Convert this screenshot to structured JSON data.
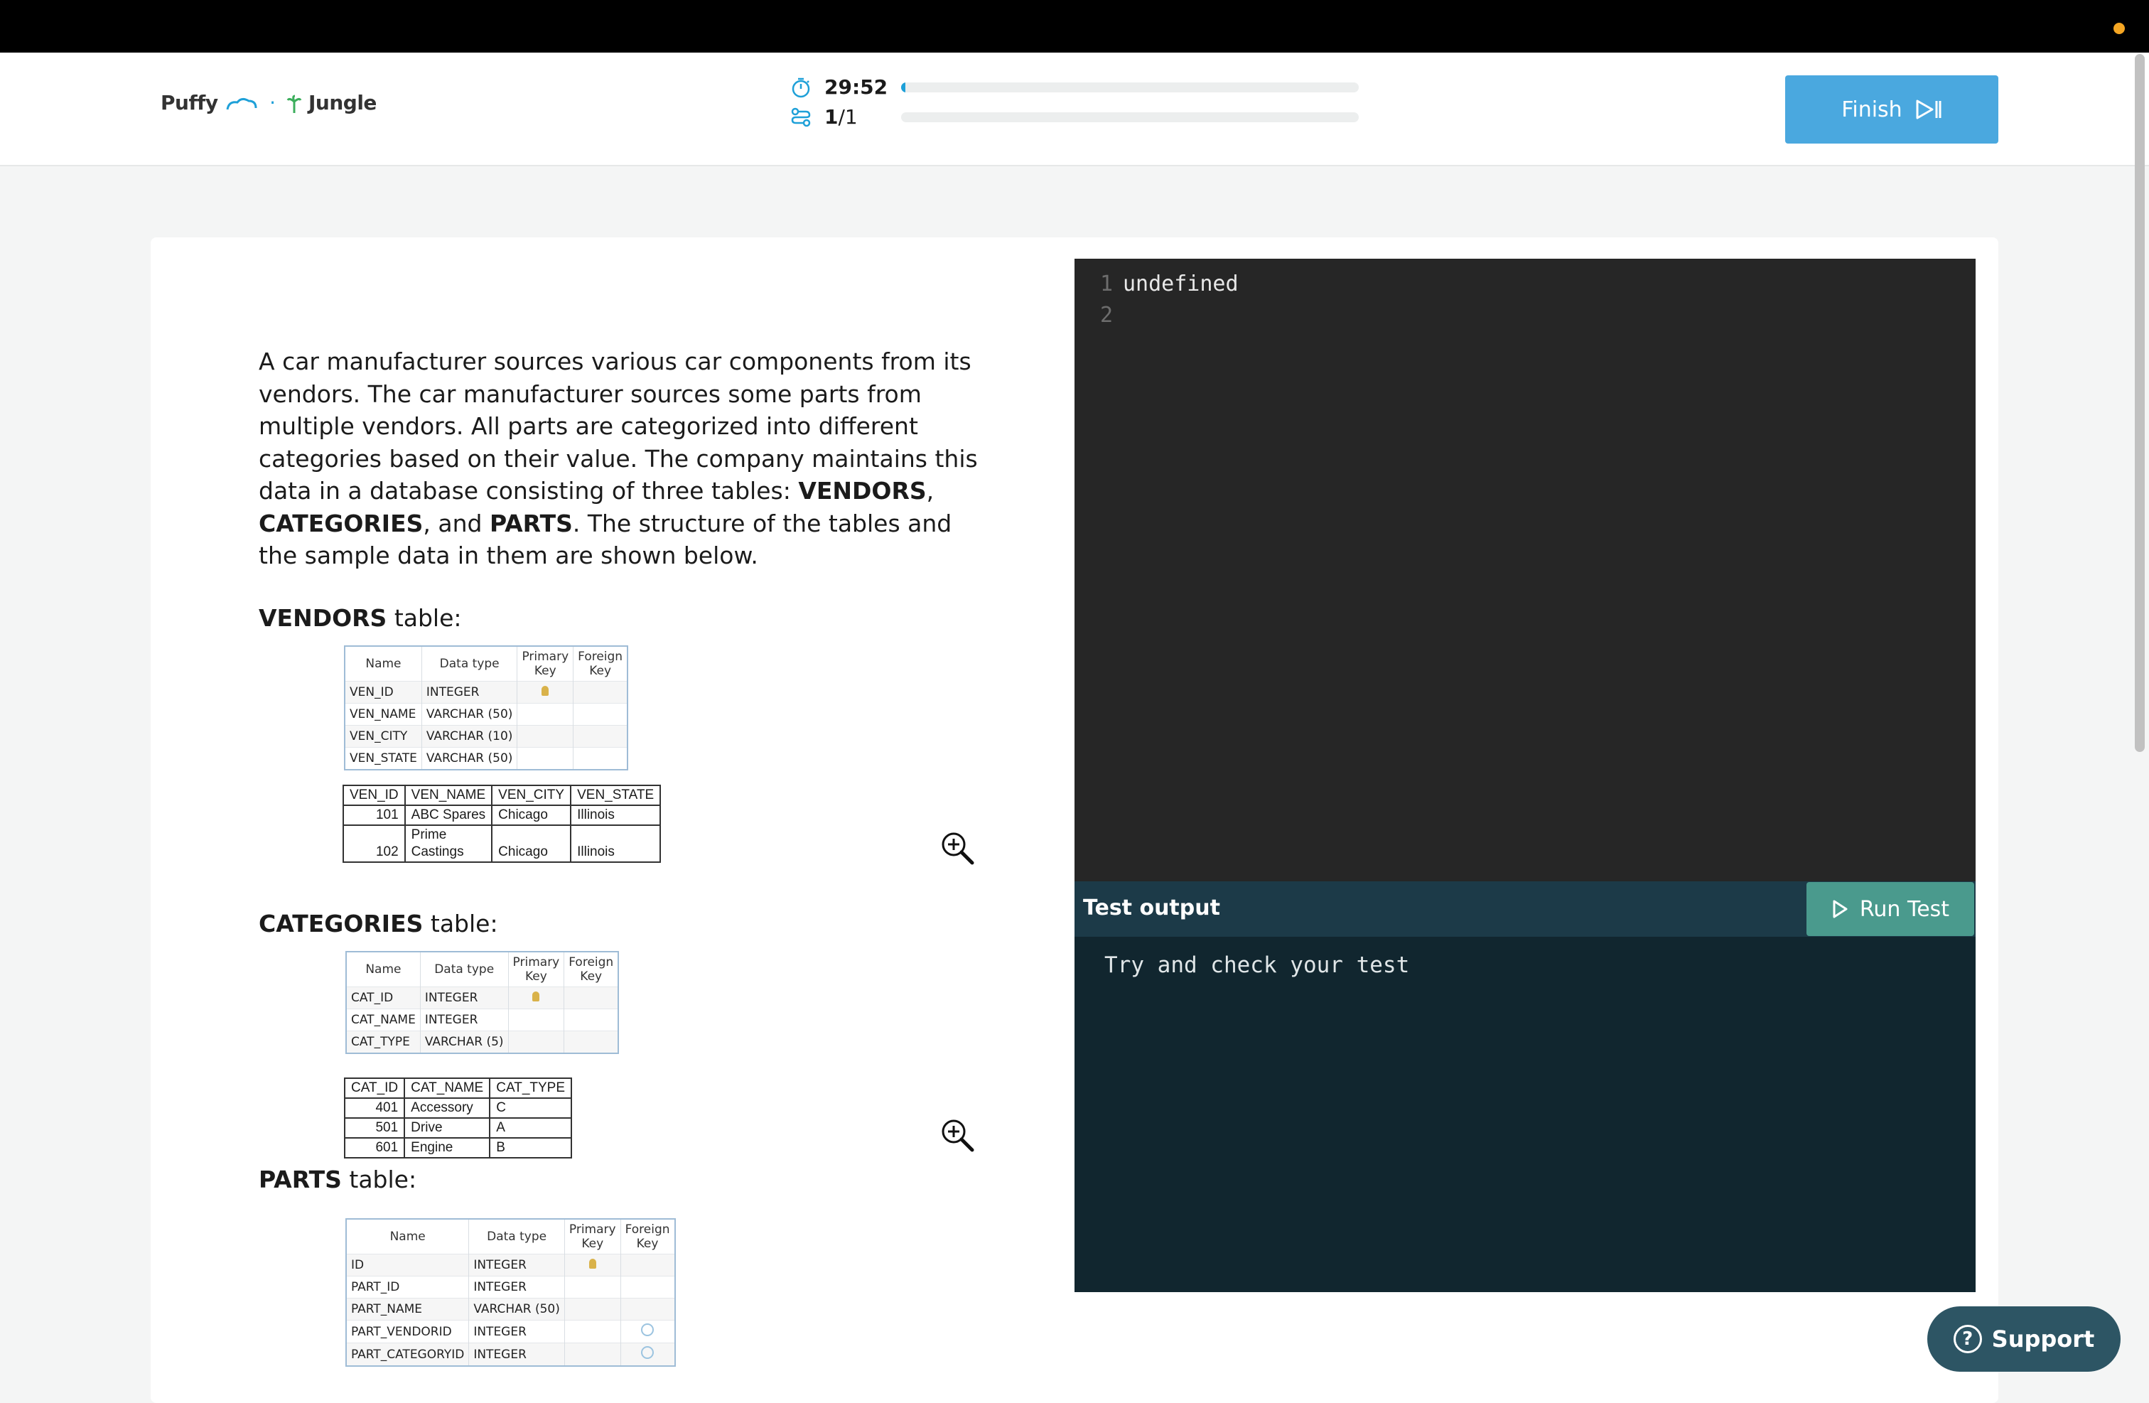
{
  "header": {
    "logo_left": "Puffy",
    "logo_sep": "·",
    "logo_right": "Jungle",
    "timer": "29:52",
    "timer_progress": 0.01,
    "question_current": "1",
    "question_total": "/1",
    "question_progress": 0.0,
    "finish_label": "Finish"
  },
  "question": {
    "intro": "A car manufacturer sources various car components from its vendors. The car manufacturer sources some parts from multiple vendors. All parts are categorized into different categories based on their value. The company maintains this data in a database consisting of three tables: ",
    "t1": "VENDORS",
    "c1": ", ",
    "t2": "CATEGORIES",
    "c2": ", and ",
    "t3": "PARTS",
    "outro": ". The structure of the tables and the sample data in them are shown below."
  },
  "vendors": {
    "title_bold": "VENDORS",
    "title_rest": " table:",
    "schema_headers": [
      "Name",
      "Data type",
      "Primary Key",
      "Foreign Key"
    ],
    "schema_rows": [
      {
        "name": "VEN_ID",
        "type": "INTEGER"
      },
      {
        "name": "VEN_NAME",
        "type": "VARCHAR (50)"
      },
      {
        "name": "VEN_CITY",
        "type": "VARCHAR (10)"
      },
      {
        "name": "VEN_STATE",
        "type": "VARCHAR (50)"
      }
    ],
    "sample_headers": [
      "VEN_ID",
      "VEN_NAME",
      "VEN_CITY",
      "VEN_STATE"
    ],
    "sample_rows": [
      [
        "101",
        "ABC Spares",
        "Chicago",
        "Illinois"
      ],
      [
        "102",
        "Prime Castings",
        "Chicago",
        "Illinois"
      ]
    ]
  },
  "categories": {
    "title_bold": "CATEGORIES",
    "title_rest": " table:",
    "schema_headers": [
      "Name",
      "Data type",
      "Primary Key",
      "Foreign Key"
    ],
    "schema_rows": [
      {
        "name": "CAT_ID",
        "type": "INTEGER"
      },
      {
        "name": "CAT_NAME",
        "type": "INTEGER"
      },
      {
        "name": "CAT_TYPE",
        "type": "VARCHAR (5)"
      }
    ],
    "sample_headers": [
      "CAT_ID",
      "CAT_NAME",
      "CAT_TYPE"
    ],
    "sample_rows": [
      [
        "401",
        "Accessory",
        "C"
      ],
      [
        "501",
        "Drive",
        "A"
      ],
      [
        "601",
        "Engine",
        "B"
      ]
    ]
  },
  "parts": {
    "title_bold": "PARTS",
    "title_rest": " table:",
    "schema_headers": [
      "Name",
      "Data type",
      "Primary Key",
      "Foreign Key"
    ],
    "schema_rows": [
      {
        "name": "ID",
        "type": "INTEGER"
      },
      {
        "name": "PART_ID",
        "type": "INTEGER"
      },
      {
        "name": "PART_NAME",
        "type": "VARCHAR (50)"
      },
      {
        "name": "PART_VENDORID",
        "type": "INTEGER"
      },
      {
        "name": "PART_CATEGORYID",
        "type": "INTEGER"
      }
    ]
  },
  "editor": {
    "lines": [
      {
        "number": "1",
        "code": "undefined"
      },
      {
        "number": "2",
        "code": ""
      }
    ]
  },
  "output": {
    "title": "Test output",
    "run_label": "Run Test",
    "message": "Try and check your test"
  },
  "support": {
    "label": "Support",
    "icon_glyph": "?"
  },
  "colors": {
    "accent": "#1ea0d8",
    "finish_button": "#4aa8df",
    "run_button": "#4a9a8d",
    "editor_bg": "#262626",
    "output_bg": "#11262f",
    "support_bg": "#2d5564"
  }
}
